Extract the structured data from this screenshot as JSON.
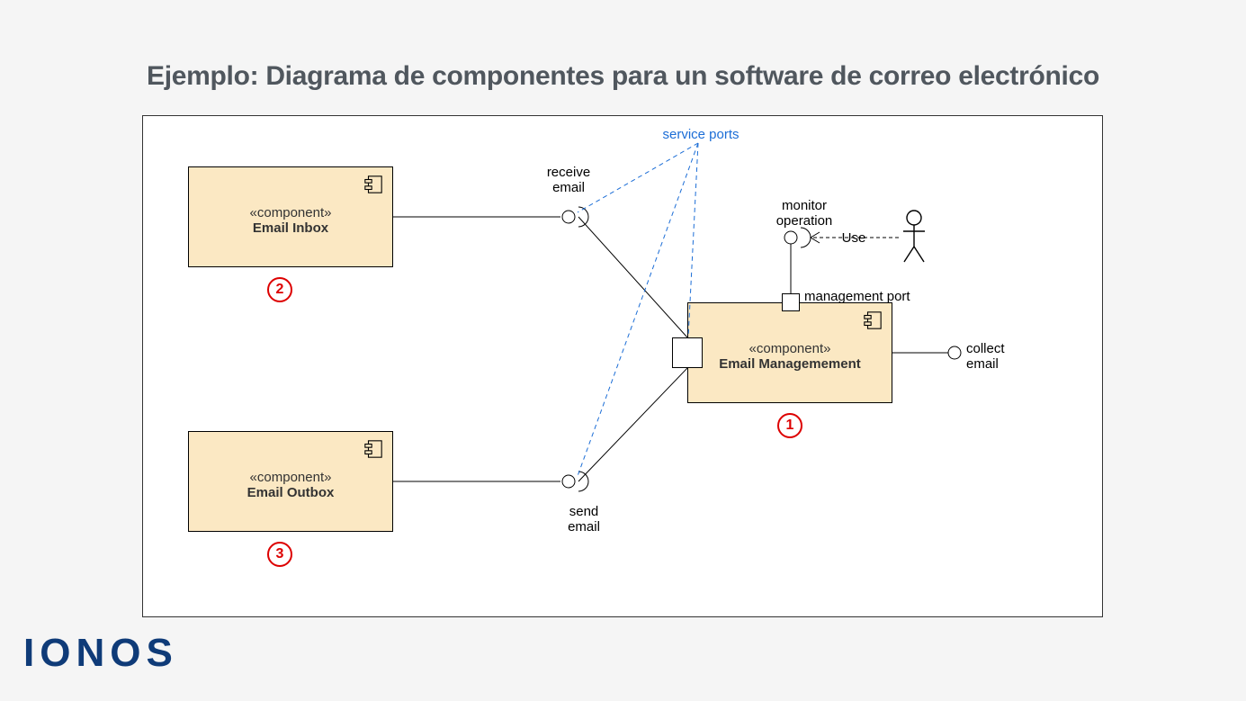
{
  "title": "Ejemplo: Diagrama de componentes para un software de correo electrónico",
  "logo": "IONOS",
  "components": {
    "inbox": {
      "stereotype": "«component»",
      "name": "Email Inbox"
    },
    "outbox": {
      "stereotype": "«component»",
      "name": "Email Outbox"
    },
    "mgmt": {
      "stereotype": "«component»",
      "name": "Email Managemement"
    }
  },
  "labels": {
    "receive1": "receive",
    "receive2": "email",
    "send1": "send",
    "send2": "email",
    "collect1": "collect",
    "collect2": "email",
    "monitor1": "monitor",
    "monitor2": "operation",
    "mgmt_port": "management port",
    "service_ports": "service ports",
    "use": "Use"
  },
  "callouts": {
    "c1": "1",
    "c2": "2",
    "c3": "3"
  }
}
